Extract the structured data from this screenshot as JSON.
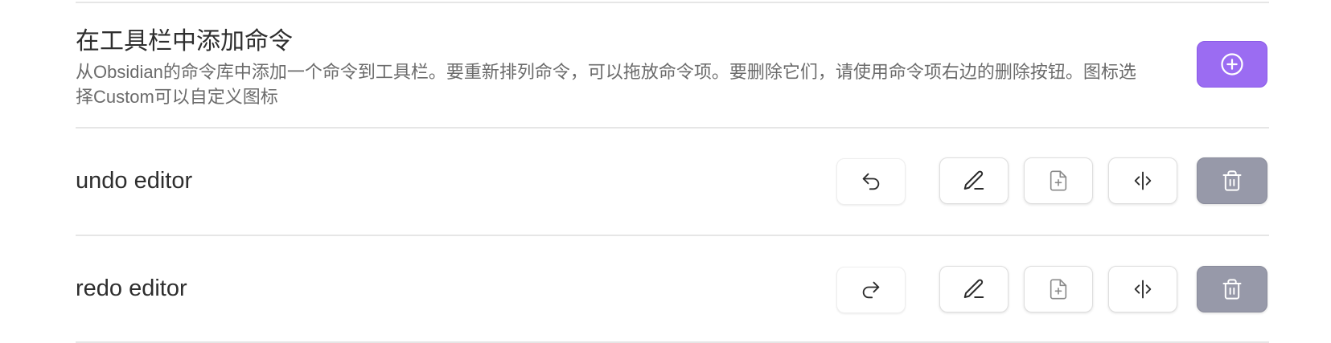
{
  "header": {
    "title": "在工具栏中添加命令",
    "description": "从Obsidian的命令库中添加一个命令到工具栏。要重新排列命令，可以拖放命令项。要删除它们，请使用命令项右边的删除按钮。图标选择Custom可以自定义图标",
    "add_button_icon": "plus-circle-icon"
  },
  "commands": [
    {
      "label": "undo editor",
      "command_icon": "undo-icon",
      "actions": [
        "edit-icon",
        "file-plus-icon",
        "split-icon",
        "trash-icon"
      ]
    },
    {
      "label": "redo editor",
      "command_icon": "redo-icon",
      "actions": [
        "edit-icon",
        "file-plus-icon",
        "split-icon",
        "trash-icon"
      ]
    }
  ],
  "colors": {
    "accent": "#9b6cf2",
    "delete_button": "#9799a9"
  }
}
